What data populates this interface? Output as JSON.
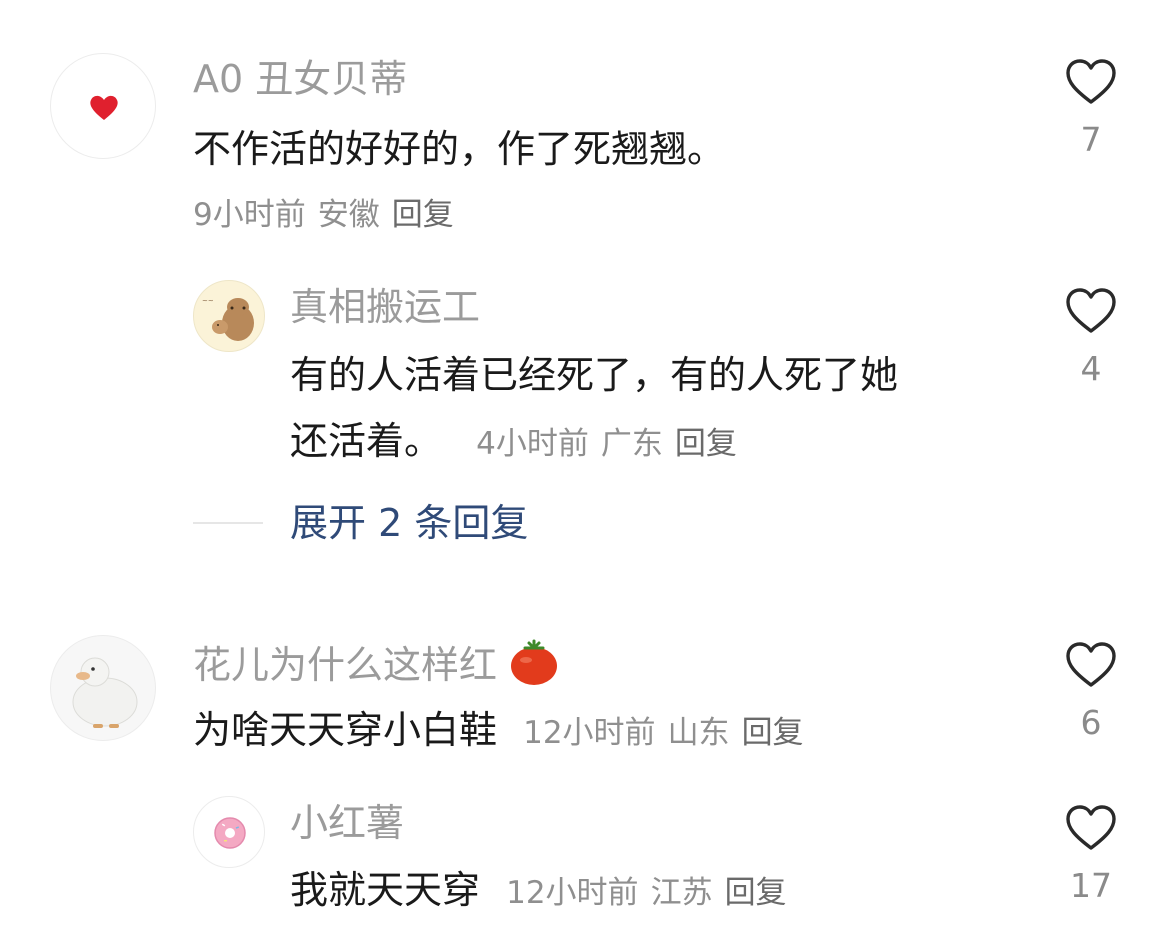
{
  "comments": [
    {
      "username": "A0 丑女贝蒂",
      "avatar_icon": "red-heart-icon",
      "text": "不作活的好好的，作了死翘翘。",
      "time": "9小时前",
      "location": "安徽",
      "reply_label": "回复",
      "likes": "7",
      "replies": [
        {
          "username": "真相搬运工",
          "avatar_icon": "capybara-icon",
          "text_line1": "有的人活着已经死了，有的人死了她",
          "text_line2": "还活着。",
          "time": "4小时前",
          "location": "广东",
          "reply_label": "回复",
          "likes": "4"
        }
      ],
      "expand_label": "展开 2 条回复"
    },
    {
      "username": "花儿为什么这样红",
      "username_emoji": "tomato-icon",
      "avatar_icon": "duck-icon",
      "text": "为啥天天穿小白鞋",
      "time": "12小时前",
      "location": "山东",
      "reply_label": "回复",
      "likes": "6",
      "replies": [
        {
          "username": "小红薯",
          "avatar_icon": "donut-icon",
          "text": "我就天天穿",
          "time": "12小时前",
          "location": "江苏",
          "reply_label": "回复",
          "likes": "17"
        }
      ]
    }
  ],
  "colors": {
    "username": "#9b9b9b",
    "content": "#1a1a1a",
    "meta": "#8f8f8f",
    "expand_link": "#2f4a78",
    "heart_red": "#e0202e"
  }
}
